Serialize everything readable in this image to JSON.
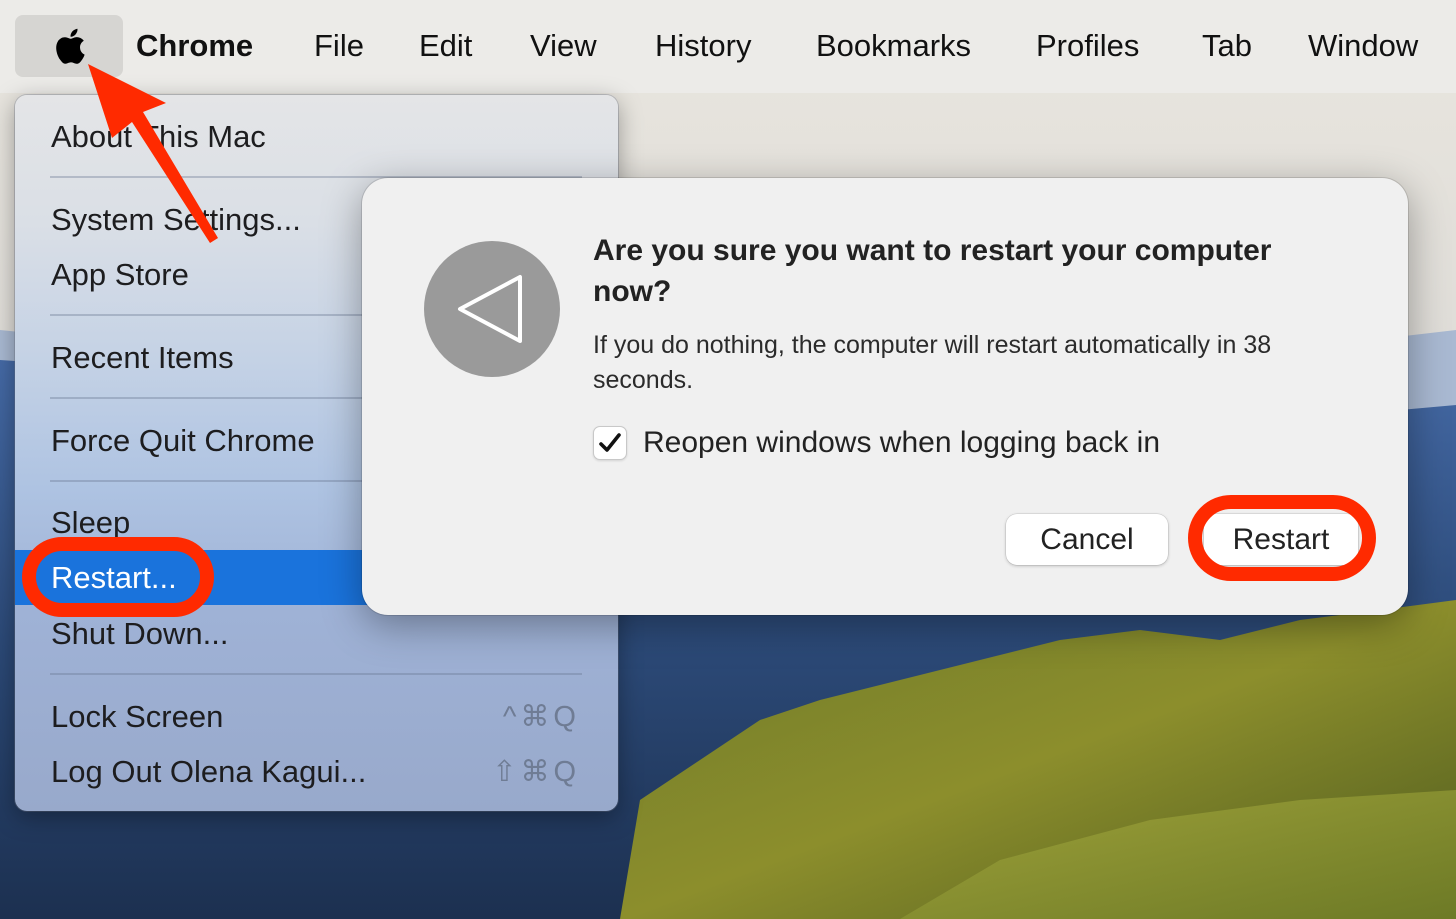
{
  "menubar": {
    "apple_icon": "apple-logo-icon",
    "app_name": "Chrome",
    "items": [
      "File",
      "Edit",
      "View",
      "History",
      "Bookmarks",
      "Profiles",
      "Tab",
      "Window"
    ]
  },
  "apple_menu": {
    "items": [
      {
        "label": "About This Mac"
      },
      {
        "label": "System Settings..."
      },
      {
        "label": "App Store"
      },
      {
        "label": "Recent Items"
      },
      {
        "label": "Force Quit Chrome"
      },
      {
        "label": "Sleep"
      },
      {
        "label": "Restart...",
        "selected": true
      },
      {
        "label": "Shut Down..."
      },
      {
        "label": "Lock Screen",
        "shortcut": "^⌘Q"
      },
      {
        "label": "Log Out Olena Kagui...",
        "shortcut": "⇧⌘Q"
      }
    ],
    "highlight_color": "#1a73dc"
  },
  "dialog": {
    "icon": "restart-triangle-icon",
    "title": "Are you sure you want to restart your computer now?",
    "body": "If you do nothing, the computer will restart automatically in 38 seconds.",
    "countdown_seconds": 38,
    "checkbox": {
      "label": "Reopen windows when logging back in",
      "checked": true
    },
    "buttons": {
      "cancel": "Cancel",
      "restart": "Restart"
    }
  },
  "annotations": {
    "color": "#ff2a00",
    "highlighted": [
      "Restart... menu item",
      "Restart button"
    ],
    "arrow_target": "Apple menu"
  }
}
